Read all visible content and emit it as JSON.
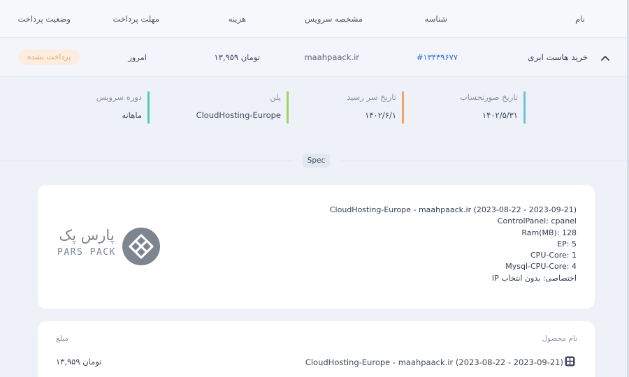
{
  "table_header": {
    "name": "نام",
    "id": "شناسه",
    "service_spec": "مشخصه سرویس",
    "cost": "هزینه",
    "due_date": "مهلت پرداخت",
    "payment_status": "وضعیت پرداخت"
  },
  "invoice_row": {
    "name": "خرید هاست ابری",
    "id": "#۱۳۴۳۹۶۷۷",
    "domain": "maahpaack.ir",
    "cost": "۱۳,۹۵۹ تومان",
    "due": "امروز",
    "status": "پرداخت نشده"
  },
  "details": [
    {
      "label": "تاریخ صورتحساب",
      "value": "۱۴۰۲/۵/۳۱",
      "accent": "#6ec1d9"
    },
    {
      "label": "تاریخ سر رسید",
      "value": "۱۴۰۲/۶/۱",
      "accent": "#f4a261"
    },
    {
      "label": "پلن",
      "value": "CloudHosting-Europe",
      "accent": "#9bd65e"
    },
    {
      "label": "دوره سرویس",
      "value": "ماهانه",
      "accent": "#4fd1a5"
    }
  ],
  "spec_tag": "Spec",
  "spec_lines": [
    "CloudHosting-Europe - maahpaack.ir (2023-08-22 - 2023-09-21)",
    "ControlPanel: cpanel",
    "Ram(MB): 128",
    "EP: 5",
    "CPU-Core: 1",
    "Mysql-CPU-Core: 4",
    "IP اختصاصی: بدون انتخاب"
  ],
  "logo": {
    "fa": "پارس پک",
    "en": "PARS PACK"
  },
  "items_table": {
    "product_header": "نام محصول",
    "amount_header": "مبلغ",
    "product": "CloudHosting-Europe - maahpaack.ir (2023-08-22 - 2023-09-21)",
    "amount": "۱۳,۹۵۹ تومان"
  },
  "colors": {
    "status_bg": "#fbeee0",
    "status_text": "#f0a062",
    "id_link": "#2f6fd6"
  }
}
